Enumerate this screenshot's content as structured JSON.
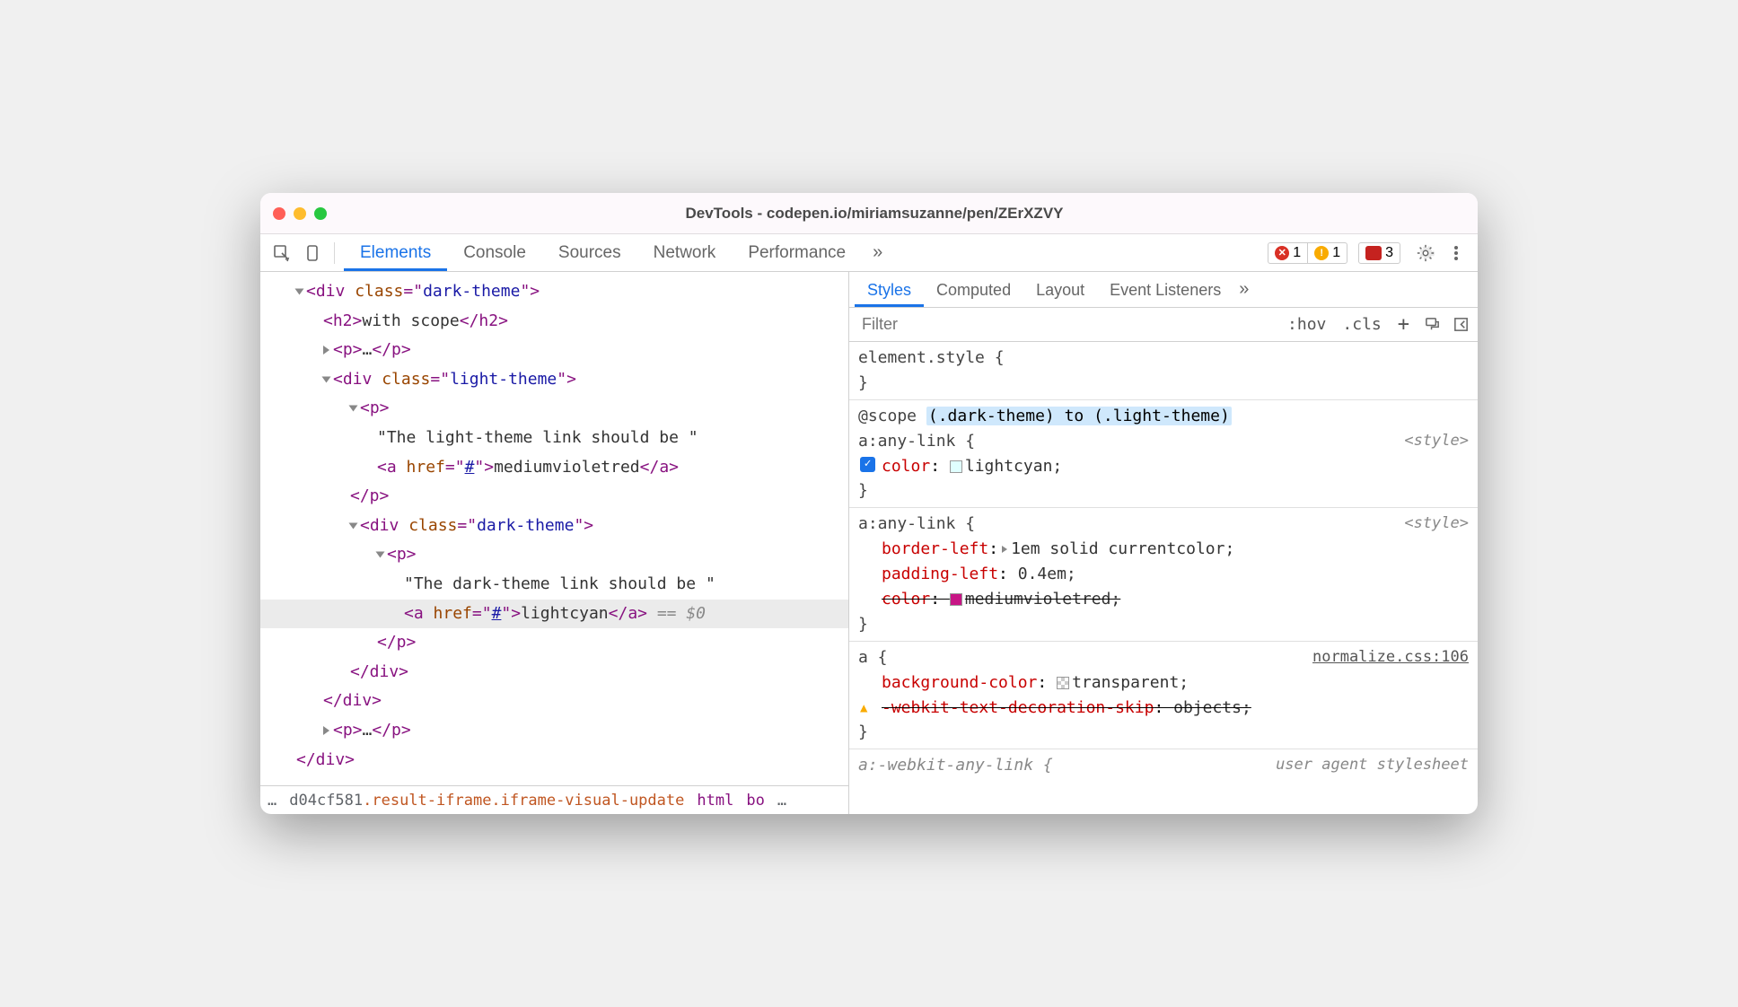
{
  "window": {
    "title": "DevTools - codepen.io/miriamsuzanne/pen/ZErXZVY"
  },
  "toolbar": {
    "tabs": [
      "Elements",
      "Console",
      "Sources",
      "Network",
      "Performance"
    ],
    "active_tab": "Elements",
    "more_glyph": "»",
    "error_count": "1",
    "warning_count": "1",
    "message_count": "3"
  },
  "dom": {
    "lines": [
      {
        "indent": 0,
        "toggle": "open",
        "parts": [
          {
            "t": "tag",
            "v": "<div "
          },
          {
            "t": "attr",
            "v": "class"
          },
          {
            "t": "tag",
            "v": "=\""
          },
          {
            "t": "attr-val",
            "v": "dark-theme"
          },
          {
            "t": "tag",
            "v": "\">"
          }
        ]
      },
      {
        "indent": 1,
        "parts": [
          {
            "t": "tag",
            "v": "<h2>"
          },
          {
            "t": "txt",
            "v": "with scope"
          },
          {
            "t": "tag",
            "v": "</h2>"
          }
        ]
      },
      {
        "indent": 1,
        "toggle": "closed",
        "parts": [
          {
            "t": "tag",
            "v": "<p>"
          },
          {
            "t": "ellips",
            "v": "…"
          },
          {
            "t": "tag",
            "v": "</p>"
          }
        ]
      },
      {
        "indent": 1,
        "toggle": "open",
        "parts": [
          {
            "t": "tag",
            "v": "<div "
          },
          {
            "t": "attr",
            "v": "class"
          },
          {
            "t": "tag",
            "v": "=\""
          },
          {
            "t": "attr-val",
            "v": "light-theme"
          },
          {
            "t": "tag",
            "v": "\">"
          }
        ]
      },
      {
        "indent": 2,
        "toggle": "open",
        "parts": [
          {
            "t": "tag",
            "v": "<p>"
          }
        ]
      },
      {
        "indent": 3,
        "parts": [
          {
            "t": "txt",
            "v": "\"The light-theme link should be \""
          }
        ]
      },
      {
        "indent": 3,
        "parts": [
          {
            "t": "tag",
            "v": "<a "
          },
          {
            "t": "attr",
            "v": "href"
          },
          {
            "t": "tag",
            "v": "=\""
          },
          {
            "t": "link",
            "v": "#"
          },
          {
            "t": "tag",
            "v": "\">"
          },
          {
            "t": "txt",
            "v": "mediumvioletred"
          },
          {
            "t": "tag",
            "v": "</a>"
          }
        ]
      },
      {
        "indent": 2,
        "parts": [
          {
            "t": "tag",
            "v": "</p>"
          }
        ]
      },
      {
        "indent": 2,
        "toggle": "open",
        "parts": [
          {
            "t": "tag",
            "v": "<div "
          },
          {
            "t": "attr",
            "v": "class"
          },
          {
            "t": "tag",
            "v": "=\""
          },
          {
            "t": "attr-val",
            "v": "dark-theme"
          },
          {
            "t": "tag",
            "v": "\">"
          }
        ]
      },
      {
        "indent": 3,
        "toggle": "open",
        "parts": [
          {
            "t": "tag",
            "v": "<p>"
          }
        ]
      },
      {
        "indent": 4,
        "parts": [
          {
            "t": "txt",
            "v": "\"The dark-theme link should be \""
          }
        ]
      },
      {
        "indent": 4,
        "selected": true,
        "parts": [
          {
            "t": "tag",
            "v": "<a "
          },
          {
            "t": "attr",
            "v": "href"
          },
          {
            "t": "tag",
            "v": "=\""
          },
          {
            "t": "link",
            "v": "#"
          },
          {
            "t": "tag",
            "v": "\">"
          },
          {
            "t": "txt",
            "v": "lightcyan"
          },
          {
            "t": "tag",
            "v": "</a>"
          },
          {
            "t": "selmark",
            "v": " == $0"
          }
        ]
      },
      {
        "indent": 3,
        "parts": [
          {
            "t": "tag",
            "v": "</p>"
          }
        ]
      },
      {
        "indent": 2,
        "parts": [
          {
            "t": "tag",
            "v": "</div>"
          }
        ]
      },
      {
        "indent": 1,
        "parts": [
          {
            "t": "tag",
            "v": "</div>"
          }
        ]
      },
      {
        "indent": 1,
        "toggle": "closed",
        "parts": [
          {
            "t": "tag",
            "v": "<p>"
          },
          {
            "t": "ellips",
            "v": "…"
          },
          {
            "t": "tag",
            "v": "</p>"
          }
        ]
      },
      {
        "indent": 0,
        "parts": [
          {
            "t": "tag",
            "v": "</div>"
          }
        ]
      }
    ]
  },
  "breadcrumb": {
    "ellipsis": "…",
    "seg1": "d04cf581",
    "seg2": ".result-iframe.iframe-visual-update",
    "seg3": "html",
    "seg4": "bo",
    "seg5": "…"
  },
  "styles_panel": {
    "subtabs": [
      "Styles",
      "Computed",
      "Layout",
      "Event Listeners"
    ],
    "active_subtab": "Styles",
    "filter_placeholder": "Filter",
    "hov": ":hov",
    "cls": ".cls",
    "plus": "+"
  },
  "styles": {
    "block1": {
      "selector": "element.style {",
      "close": "}"
    },
    "block2": {
      "scope": "@scope ",
      "scope_hl": "(.dark-theme) to (.light-theme)",
      "selector": "a:any-link {",
      "src": "<style>",
      "prop1": {
        "name": "color",
        "sep": ": ",
        "val": "lightcyan;"
      },
      "close": "}"
    },
    "block3": {
      "selector": "a:any-link {",
      "src": "<style>",
      "prop1": {
        "name": "border-left",
        "sep": ":",
        "val": "1em solid currentcolor;"
      },
      "prop2": {
        "name": "padding-left",
        "sep": ": ",
        "val": "0.4em;"
      },
      "prop3": {
        "name": "color",
        "sep": ": ",
        "val": "mediumvioletred;"
      },
      "close": "}"
    },
    "block4": {
      "selector": "a {",
      "src": "normalize.css:106",
      "prop1": {
        "name": "background-color",
        "sep": ": ",
        "val": "transparent;"
      },
      "prop2": {
        "name": "-webkit-text-decoration-skip",
        "sep": ": ",
        "val": "objects;"
      },
      "close": "}"
    },
    "block5": {
      "selector": "a:-webkit-any-link {",
      "src": "user agent stylesheet"
    }
  }
}
